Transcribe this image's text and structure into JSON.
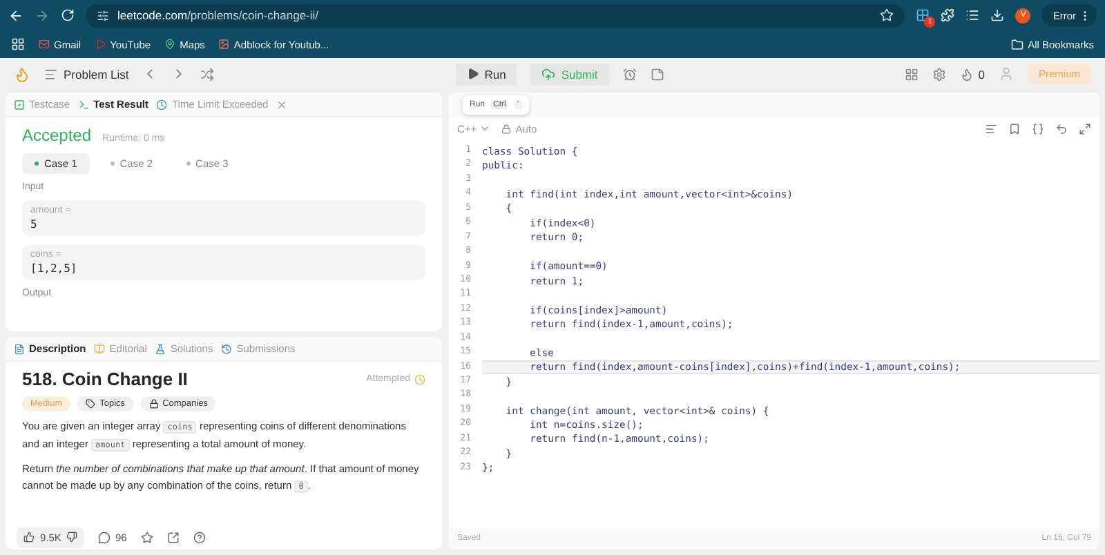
{
  "browser": {
    "url_host": "leetcode.com",
    "url_path": "/problems/coin-change-ii/",
    "bookmarks": [
      "Gmail",
      "YouTube",
      "Maps",
      "Adblock for Youtub..."
    ],
    "all_bookmarks": "All Bookmarks",
    "extension_badge": "1",
    "avatar": "V",
    "profile_button": "Error"
  },
  "nav": {
    "problem_list": "Problem List",
    "run": "Run",
    "submit": "Submit",
    "streak": "0",
    "premium": "Premium"
  },
  "result_panel": {
    "tabs": [
      {
        "label": "Testcase",
        "selected": false
      },
      {
        "label": "Test Result",
        "selected": true
      },
      {
        "label": "Time Limit Exceeded",
        "selected": false
      }
    ],
    "status": "Accepted",
    "runtime": "Runtime: 0 ms",
    "cases": [
      {
        "label": "Case 1",
        "selected": true
      },
      {
        "label": "Case 2",
        "selected": false
      },
      {
        "label": "Case 3",
        "selected": false
      }
    ],
    "input_label": "Input",
    "inputs": [
      {
        "name": "amount =",
        "value": "5"
      },
      {
        "name": "coins =",
        "value": "[1,2,5]"
      }
    ],
    "output_label": "Output"
  },
  "description_panel": {
    "tabs": [
      {
        "label": "Description",
        "selected": true
      },
      {
        "label": "Editorial",
        "selected": false
      },
      {
        "label": "Solutions",
        "selected": false
      },
      {
        "label": "Submissions",
        "selected": false
      }
    ],
    "title": "518. Coin Change II",
    "status": "Attempted",
    "difficulty": "Medium",
    "tags": [
      "Topics",
      "Companies"
    ],
    "paragraphs": [
      [
        {
          "kind": "text",
          "text": "You are given an integer array "
        },
        {
          "kind": "code",
          "text": "coins"
        },
        {
          "kind": "text",
          "text": " representing coins of different denominations and an integer "
        },
        {
          "kind": "code",
          "text": "amount"
        },
        {
          "kind": "text",
          "text": " representing a total amount of money."
        }
      ],
      [
        {
          "kind": "text",
          "text": "Return "
        },
        {
          "kind": "italic",
          "text": "the number of combinations that make up that amount"
        },
        {
          "kind": "text",
          "text": ". If that amount of money cannot be made up by any combination of the coins, return "
        },
        {
          "kind": "code",
          "text": "0"
        },
        {
          "kind": "text",
          "text": "."
        }
      ]
    ],
    "likes": "9.5K",
    "comments": "96"
  },
  "editor": {
    "tooltip": {
      "label": "Run",
      "key": "Ctrl",
      "key2": "'"
    },
    "language": "C++",
    "mode": "Auto",
    "lines": [
      {
        "n": "1",
        "text": "class Solution {",
        "current": false
      },
      {
        "n": "2",
        "text": "public:",
        "current": false
      },
      {
        "n": "3",
        "current": false
      },
      {
        "n": "4",
        "text": "    int find(int index,int amount,vector<int>&coins)",
        "current": false
      },
      {
        "n": "5",
        "text": "    {",
        "current": false
      },
      {
        "n": "6",
        "text": "        if(index<0)",
        "current": false
      },
      {
        "n": "7",
        "text": "        return 0;",
        "current": false
      },
      {
        "n": "8",
        "current": false
      },
      {
        "n": "9",
        "text": "        if(amount==0)",
        "current": false
      },
      {
        "n": "10",
        "text": "        return 1;",
        "current": false
      },
      {
        "n": "11",
        "current": false
      },
      {
        "n": "12",
        "text": "        if(coins[index]>amount)",
        "current": false
      },
      {
        "n": "13",
        "text": "        return find(index-1,amount,coins);",
        "current": false
      },
      {
        "n": "14",
        "current": false
      },
      {
        "n": "15",
        "text": "        else",
        "current": false
      },
      {
        "n": "16",
        "text": "        return find(index,amount-coins[index],coins)+find(index-1,amount,coins);",
        "current": true
      },
      {
        "n": "17",
        "text": "    }",
        "current": false
      },
      {
        "n": "18",
        "current": false
      },
      {
        "n": "19",
        "text": "    int change(int amount, vector<int>& coins) {",
        "current": false
      },
      {
        "n": "20",
        "text": "        int n=coins.size();",
        "current": false
      },
      {
        "n": "21",
        "text": "        return find(n-1,amount,coins);",
        "current": false
      },
      {
        "n": "22",
        "text": "    }",
        "current": false
      },
      {
        "n": "23",
        "text": "};",
        "current": false
      }
    ],
    "saved": "Saved",
    "position": "Ln 16, Col 79"
  }
}
